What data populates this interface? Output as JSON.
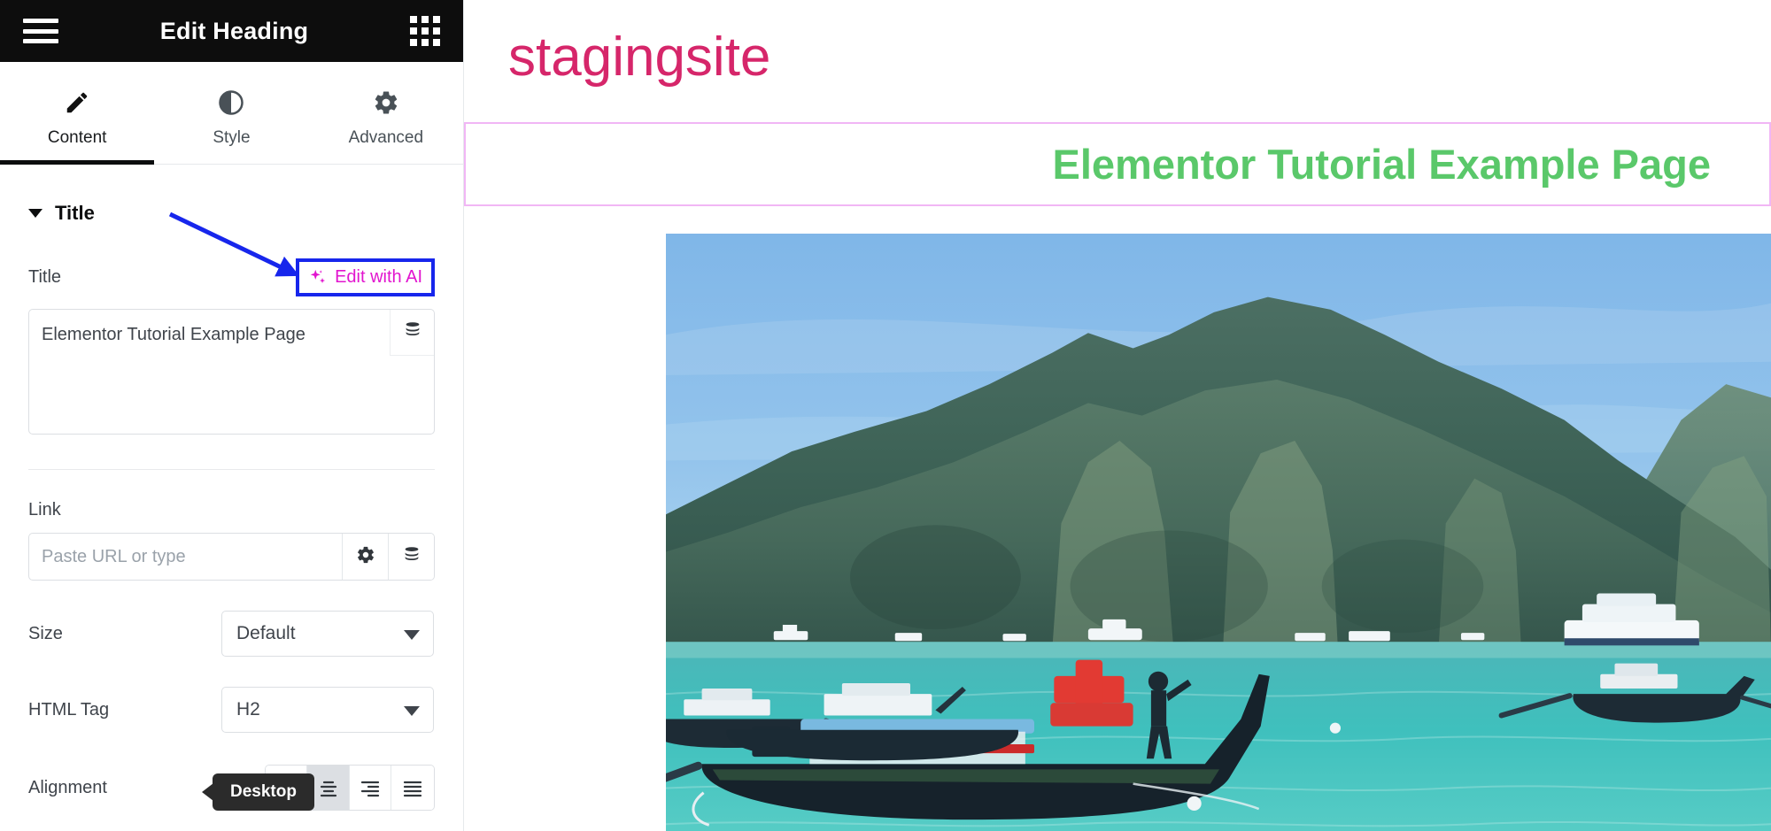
{
  "panel": {
    "header": {
      "menu_icon": "hamburger-icon",
      "title": "Edit Heading",
      "widgets_icon": "grid-icon"
    },
    "tabs": [
      {
        "label": "Content",
        "icon": "pencil-icon",
        "active": true
      },
      {
        "label": "Style",
        "icon": "contrast-circle-icon",
        "active": false
      },
      {
        "label": "Advanced",
        "icon": "gear-icon",
        "active": false
      }
    ],
    "section": {
      "title": "Title",
      "collapse_icon": "caret-down-icon"
    },
    "title_field": {
      "label": "Title",
      "ai_button": "Edit with AI",
      "ai_icon": "sparkles-icon",
      "value": "Elementor Tutorial Example Page",
      "dynamic_icon": "database-stack-icon"
    },
    "link_field": {
      "label": "Link",
      "placeholder": "Paste URL or type",
      "value": "",
      "options_icon": "gear-icon",
      "dynamic_icon": "database-stack-icon"
    },
    "size_field": {
      "label": "Size",
      "value": "Default"
    },
    "html_tag_field": {
      "label": "HTML Tag",
      "value": "H2"
    },
    "alignment_field": {
      "label": "Alignment",
      "device_icon": "desktop-monitor-icon",
      "tooltip": "Desktop",
      "buttons": [
        {
          "name": "align-left",
          "selected": false
        },
        {
          "name": "align-center",
          "selected": true
        },
        {
          "name": "align-right",
          "selected": false
        },
        {
          "name": "align-justify",
          "selected": false
        }
      ]
    },
    "collapse_handle_icon": "chevron-left-icon"
  },
  "preview": {
    "site_logo": "stagingsite",
    "heading": "Elementor Tutorial Example Page",
    "hero_image_alt": "tropical bay with longtail boats and limestone karst mountains"
  },
  "annotations": {
    "ai_arrow": "blue-arrow-pointing-to-edit-with-ai",
    "ai_highlight_color": "#1726ec"
  },
  "colors": {
    "panel_header_bg": "#0d0d0d",
    "ai_magenta": "#e215cf",
    "logo_pink": "#d6266a",
    "heading_green": "#5ac86a",
    "heading_box_border": "#f1b6f5",
    "device_icon_magenta": "#e215cf",
    "tooltip_bg": "#2b2b2b"
  }
}
